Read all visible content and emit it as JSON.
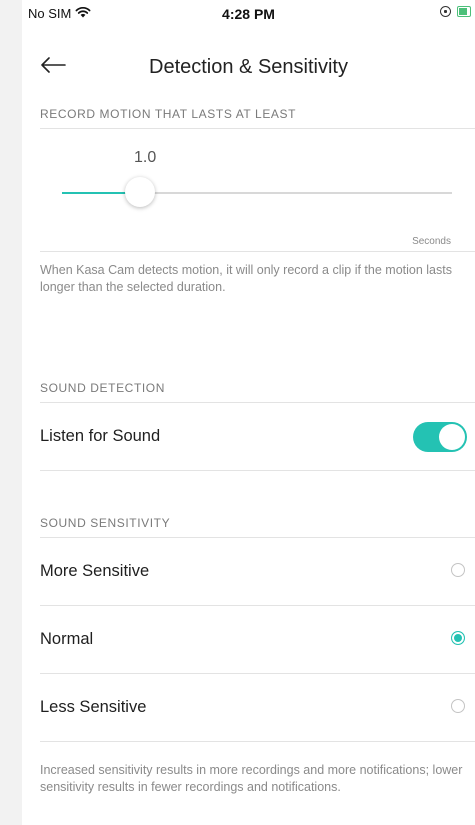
{
  "status_bar": {
    "carrier": "No SIM",
    "time": "4:28 PM",
    "icons": [
      "wifi-icon",
      "orientation-lock-icon",
      "battery-icon"
    ]
  },
  "nav": {
    "title": "Detection & Sensitivity",
    "back_icon": "arrow-left-icon"
  },
  "motion": {
    "header": "RECORD MOTION THAT LASTS AT LEAST",
    "slider": {
      "value_label": "1.0",
      "fraction": 0.2
    },
    "unit": "Seconds",
    "help": "When Kasa Cam detects motion, it will only record a clip if the motion lasts longer than the selected duration."
  },
  "sound_detection": {
    "header": "SOUND DETECTION",
    "listen_label": "Listen for Sound",
    "listen_enabled": true
  },
  "sound_sensitivity": {
    "header": "SOUND SENSITIVITY",
    "options": [
      {
        "label": "More Sensitive",
        "selected": false
      },
      {
        "label": "Normal",
        "selected": true
      },
      {
        "label": "Less Sensitive",
        "selected": false
      }
    ],
    "help": "Increased sensitivity results in more recordings and more notifications; lower sensitivity results in fewer recordings and notifications."
  },
  "colors": {
    "accent": "#24c2b3",
    "divider": "#e3e3e3",
    "muted_text": "#8a8a8a"
  }
}
